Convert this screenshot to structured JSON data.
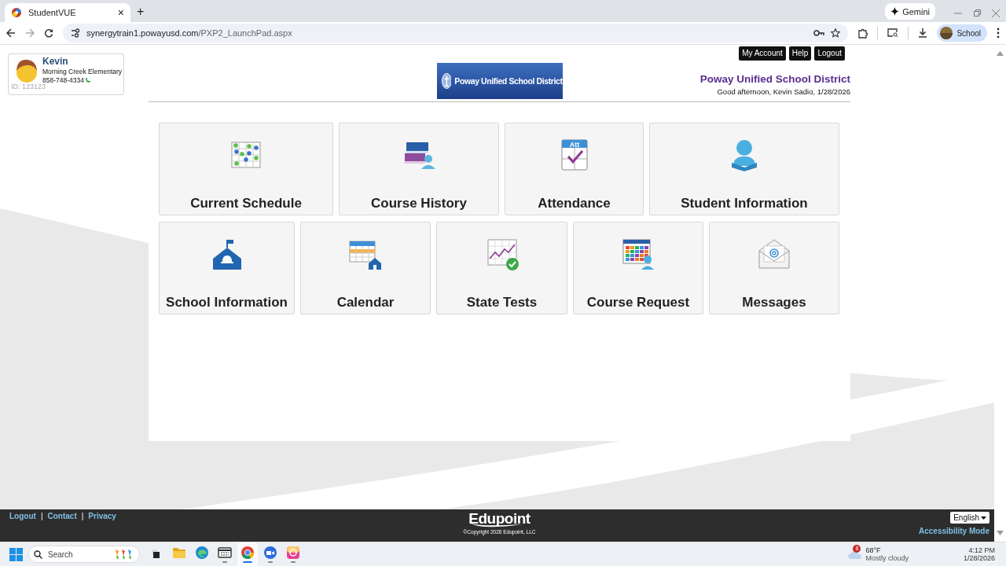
{
  "browser": {
    "tabs": [
      {
        "label": "StudentVUE",
        "selected": true,
        "close": "×"
      }
    ],
    "new_tab": "+",
    "gemini": "Gemini",
    "url_host": "synergytrain1.powayusd.com",
    "url_path": "/PXP2_LaunchPad.aspx",
    "profile": "School"
  },
  "student": {
    "name": "Kevin",
    "school": "Morning Creek Elementary",
    "phone": "858-748-4334",
    "id": "ID: 123123"
  },
  "top_buttons": [
    "My Account",
    "Help",
    "Logout"
  ],
  "logo_text": "Poway Unified School District",
  "district": "Poway Unified School District",
  "greeting": "Good afternoon, Kevin Sadio, 1/28/2026",
  "tile_rows": [
    {
      "tiles": [
        {
          "label": "Current Schedule"
        },
        {
          "label": "Course History"
        },
        {
          "label": "Attendance",
          "icon_text": "Att"
        },
        {
          "label": "Student Information"
        }
      ]
    },
    {
      "tiles": [
        {
          "label": "School Information"
        },
        {
          "label": "Calendar"
        },
        {
          "label": "State Tests"
        },
        {
          "label": "Course Request"
        },
        {
          "label": "Messages"
        }
      ]
    }
  ],
  "footer": {
    "items": [
      {
        "kind": "link",
        "text": "Logout"
      },
      {
        "kind": "separator",
        "text": "|"
      },
      {
        "kind": "link",
        "text": "Contact"
      },
      {
        "kind": "separator",
        "text": "|"
      },
      {
        "kind": "link",
        "text": "Privacy"
      }
    ],
    "brand": "Edupoint",
    "copyright": "©Copyright 2026 Edupoint, LLC",
    "language": "English",
    "accessibility": "Accessibility Mode"
  },
  "taskbar": {
    "search": "Search",
    "apps": [
      {
        "running": false,
        "selected": false
      },
      {
        "running": false,
        "selected": false
      },
      {
        "running": false,
        "selected": false
      },
      {
        "running": true,
        "selected": false
      },
      {
        "running": true,
        "selected": true
      },
      {
        "running": true,
        "selected": false
      },
      {
        "running": true,
        "selected": false
      }
    ],
    "weather": {
      "badge": "8",
      "temp": "68°F",
      "condition": "Mostly cloudy"
    },
    "time": "4:12 PM",
    "date": "1/28/2026"
  }
}
